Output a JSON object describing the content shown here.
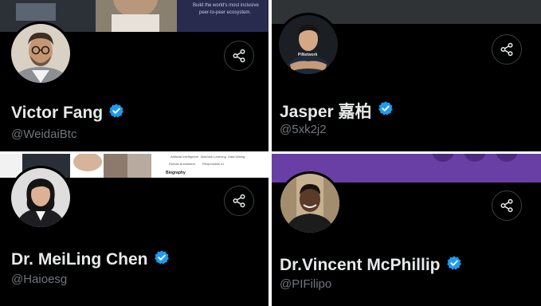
{
  "colors": {
    "background": "#000000",
    "name": "#e7e9ea",
    "handle": "#71767b",
    "verified": "#1d9bf0",
    "divider": "#ffffff",
    "purple_banner": "#6a3fa5"
  },
  "profiles": [
    {
      "name": "Victor Fang",
      "handle": "@WeidaiBtc",
      "verified": true,
      "banner_text": [
        "Build the world's most inclusive",
        "peer-to-peer ecosystem."
      ]
    },
    {
      "name": "Jasper 嘉柏",
      "handle": "@5xk2j2",
      "verified": true,
      "shirt_text": "PiNetwork"
    },
    {
      "name": "Dr. MeiLing Chen",
      "handle": "@Haioesg",
      "verified": true,
      "banner_doc": {
        "tags_row1": [
          "Artificial Intelligence",
          "Machine Learning",
          "Data Mining"
        ],
        "tags_row2": [
          "Human Annotation",
          "Responsible AI"
        ],
        "heading": "Biography"
      }
    },
    {
      "name": "Dr.Vincent McPhillip",
      "handle": "@PIFilipo",
      "verified": true
    }
  ],
  "icons": {
    "share": "share-icon",
    "verified": "verified-badge-icon"
  }
}
